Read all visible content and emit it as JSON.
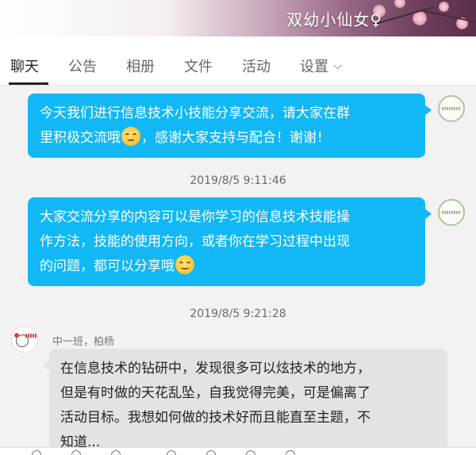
{
  "header": {
    "title": "双幼小仙女♀"
  },
  "tabs": [
    {
      "label": "聊天"
    },
    {
      "label": "公告"
    },
    {
      "label": "相册"
    },
    {
      "label": "文件"
    },
    {
      "label": "活动"
    },
    {
      "label": "设置"
    }
  ],
  "messages": [
    {
      "lines": [
        "今天我们进行信息技术小技能分享交流，请大家在群",
        "里积极交流哦",
        "，感谢大家支持与配合！谢谢！"
      ],
      "emoji": "smile-emoji"
    },
    {
      "timestamp": "2019/8/5 9:11:46"
    },
    {
      "lines": [
        "大家交流分享的内容可以是你学习的信息技术技能操",
        "作方法，技能的使用方向，或者你在学习过程中出现",
        "的问题，都可以分享哦"
      ],
      "emoji": "smile-emoji"
    },
    {
      "timestamp": "2019/8/5 9:21:28"
    },
    {
      "sender": "中一班，柏杨",
      "lines": [
        "在信息技术的钻研中，发现很多可以炫技术的地方，",
        "但是有时做的天花乱坠，自我觉得完美，可是偏离了",
        "活动目标。我想如何做的技术好而且能直至主题，不",
        "知道..."
      ]
    }
  ],
  "colors": {
    "outgoing_bubble": "#12b7f5",
    "incoming_bubble": "#e3e3e3",
    "background": "#f2f2f2"
  }
}
